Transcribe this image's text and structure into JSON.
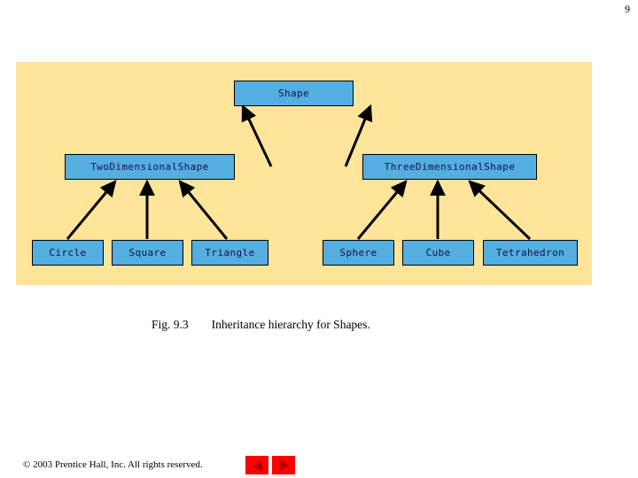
{
  "slide": {
    "page_number": "9",
    "panel_color": "#ffe49a",
    "node_fill_color": "#55aee0",
    "node_text_color": "#10104a",
    "arrow_color": "#000000"
  },
  "diagram": {
    "type": "inheritance-hierarchy",
    "root": {
      "id": "shape",
      "label": "Shape"
    },
    "level2": [
      {
        "id": "two-dimensional-shape",
        "label": "TwoDimensionalShape"
      },
      {
        "id": "three-dimensional-shape",
        "label": "ThreeDimensionalShape"
      }
    ],
    "leaves_left": [
      {
        "id": "circle",
        "label": "Circle"
      },
      {
        "id": "square",
        "label": "Square"
      },
      {
        "id": "triangle",
        "label": "Triangle"
      }
    ],
    "leaves_right": [
      {
        "id": "sphere",
        "label": "Sphere"
      },
      {
        "id": "cube",
        "label": "Cube"
      },
      {
        "id": "tetrahedron",
        "label": "Tetrahedron"
      }
    ]
  },
  "caption": {
    "figure_number": "Fig. 9.3",
    "text": "Inheritance hierarchy for Shapes."
  },
  "footer": {
    "copyright": "© 2003 Prentice Hall, Inc. All rights reserved.",
    "prev_label": "Previous slide",
    "next_label": "Next slide"
  }
}
